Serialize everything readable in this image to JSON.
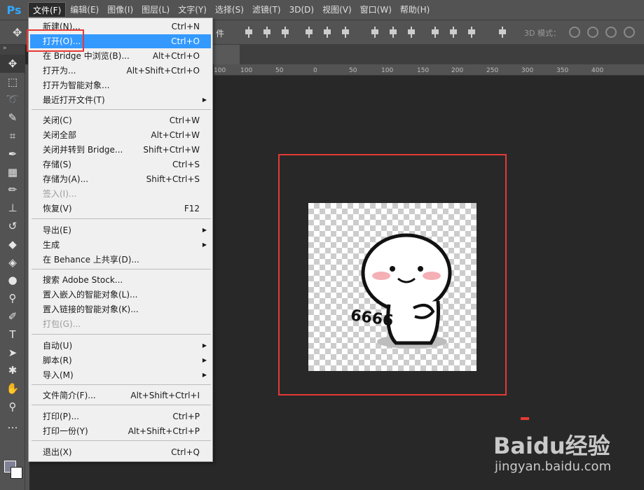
{
  "app": {
    "logo": "Ps"
  },
  "menubar": [
    "文件(F)",
    "编辑(E)",
    "图像(I)",
    "图层(L)",
    "文字(Y)",
    "选择(S)",
    "滤镜(T)",
    "3D(D)",
    "视图(V)",
    "窗口(W)",
    "帮助(H)"
  ],
  "options_bar": {
    "label_partial": "件",
    "mode_3d": "3D 模式："
  },
  "ruler_ticks": [
    "100",
    "50",
    "0",
    "50",
    "100",
    "150",
    "200",
    "250",
    "300",
    "350",
    "400"
  ],
  "file_menu": [
    {
      "label": "新建(N)...",
      "shortcut": "Ctrl+N"
    },
    {
      "label": "打开(O)...",
      "shortcut": "Ctrl+O",
      "highlighted": true
    },
    {
      "label": "在 Bridge 中浏览(B)...",
      "shortcut": "Alt+Ctrl+O"
    },
    {
      "label": "打开为...",
      "shortcut": "Alt+Shift+Ctrl+O"
    },
    {
      "label": "打开为智能对象..."
    },
    {
      "label": "最近打开文件(T)",
      "submenu": true
    },
    {
      "label": "关闭(C)",
      "shortcut": "Ctrl+W"
    },
    {
      "label": "关闭全部",
      "shortcut": "Alt+Ctrl+W"
    },
    {
      "label": "关闭并转到 Bridge...",
      "shortcut": "Shift+Ctrl+W"
    },
    {
      "label": "存储(S)",
      "shortcut": "Ctrl+S"
    },
    {
      "label": "存储为(A)...",
      "shortcut": "Shift+Ctrl+S"
    },
    {
      "label": "签入(I)...",
      "disabled": true
    },
    {
      "label": "恢复(V)",
      "shortcut": "F12"
    },
    {
      "label": "导出(E)",
      "submenu": true
    },
    {
      "label": "生成",
      "submenu": true
    },
    {
      "label": "在 Behance 上共享(D)..."
    },
    {
      "label": "搜索 Adobe Stock..."
    },
    {
      "label": "置入嵌入的智能对象(L)..."
    },
    {
      "label": "置入链接的智能对象(K)..."
    },
    {
      "label": "打包(G)...",
      "disabled": true
    },
    {
      "label": "自动(U)",
      "submenu": true
    },
    {
      "label": "脚本(R)",
      "submenu": true
    },
    {
      "label": "导入(M)",
      "submenu": true
    },
    {
      "label": "文件简介(F)...",
      "shortcut": "Alt+Shift+Ctrl+I"
    },
    {
      "label": "打印(P)...",
      "shortcut": "Ctrl+P"
    },
    {
      "label": "打印一份(Y)",
      "shortcut": "Alt+Shift+Ctrl+P"
    },
    {
      "label": "退出(X)",
      "shortcut": "Ctrl+Q"
    }
  ],
  "canvas_image": {
    "caption_text": "6666"
  },
  "watermark": {
    "logo": "Baidu经验",
    "sub": "jingyan.baidu.com"
  },
  "colors": {
    "accent_highlight": "#3399ff",
    "annotation_red": "#e53935",
    "ps_blue": "#31a8ff"
  }
}
